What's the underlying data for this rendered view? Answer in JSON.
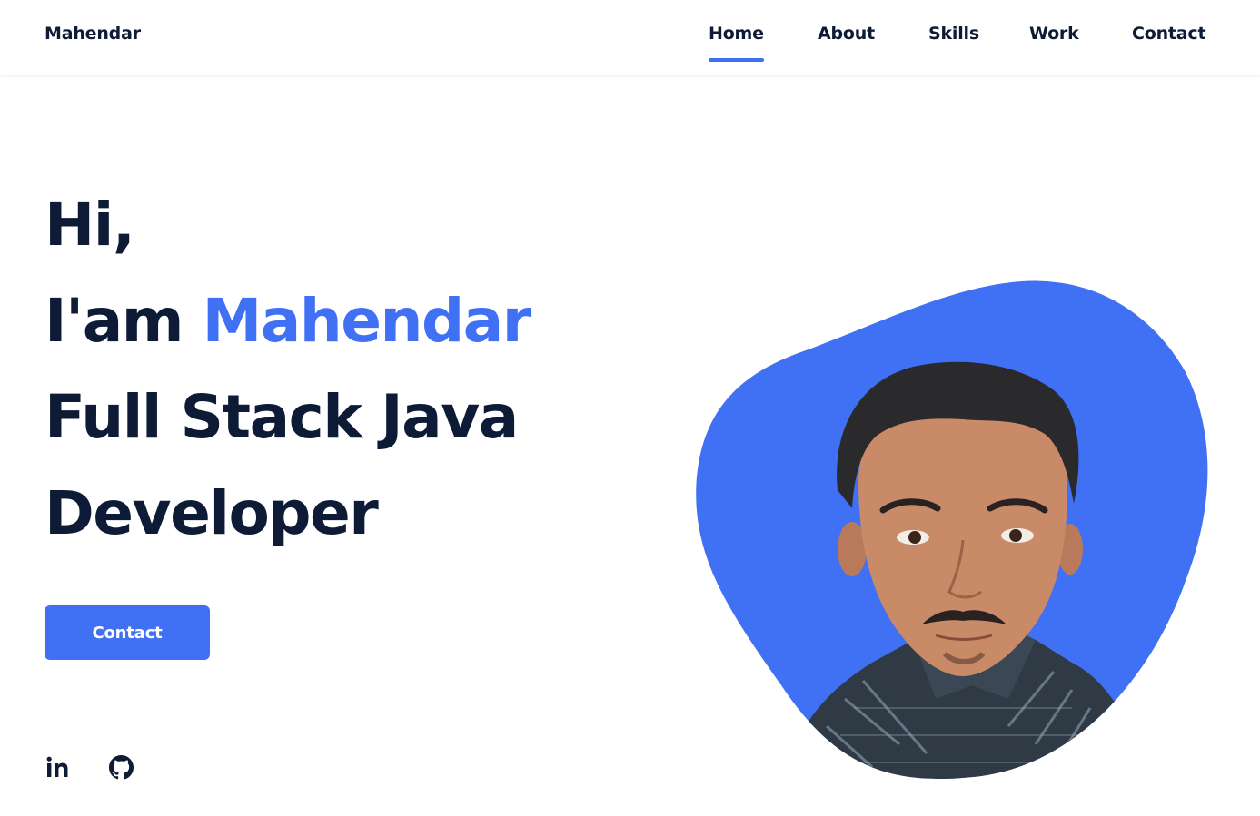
{
  "site": {
    "logo": "Mahendar"
  },
  "nav": {
    "items": [
      {
        "label": "Home",
        "active": true
      },
      {
        "label": "About",
        "active": false
      },
      {
        "label": "Skills",
        "active": false
      },
      {
        "label": "Work",
        "active": false
      },
      {
        "label": "Contact",
        "active": false
      }
    ]
  },
  "hero": {
    "line1": "Hi,",
    "line2_prefix": "I'am ",
    "line2_name": "Mahendar",
    "line3": "Full Stack Java",
    "line4": "Developer",
    "button_label": "Contact"
  },
  "social": {
    "icons": [
      "linkedin-icon",
      "github-icon"
    ]
  },
  "colors": {
    "accent": "#4070f4",
    "text": "#0e1b36",
    "background": "#ffffff"
  }
}
